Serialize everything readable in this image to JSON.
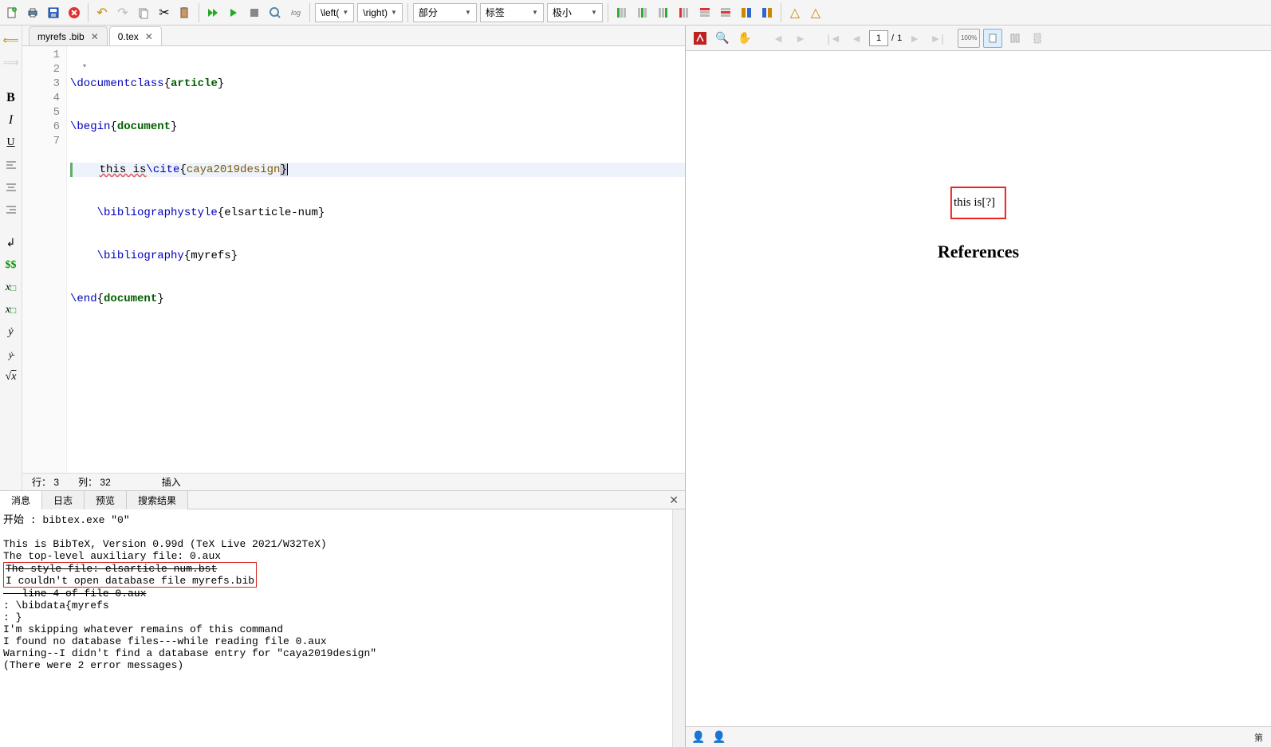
{
  "toolbar": {
    "dd_left_delim": "\\left(",
    "dd_right_delim": "\\right)",
    "dd_section": "部分",
    "dd_label": "标签",
    "dd_size": "极小"
  },
  "tabs": {
    "tab1": "myrefs .bib",
    "tab2": "0.tex"
  },
  "editor": {
    "lines": {
      "n1": "1",
      "n2": "2",
      "n3": "3",
      "n4": "4",
      "n5": "5",
      "n6": "6",
      "n7": "7"
    },
    "code": {
      "l1_cmd": "\\documentclass",
      "l1_arg": "article",
      "l2_cmd": "\\begin",
      "l2_arg": "document",
      "l3_plain": "this is",
      "l3_cmd": "\\cite",
      "l3_arg": "caya2019design",
      "l4_cmd": "\\bibliographystyle",
      "l4_arg": "elsarticle-num",
      "l5_cmd": "\\bibliography",
      "l5_arg": "myrefs",
      "l6_cmd": "\\end",
      "l6_arg": "document"
    }
  },
  "status": {
    "row_lbl": "行：",
    "row_val": "3",
    "col_lbl": "列：",
    "col_val": "32",
    "mode": "插入"
  },
  "msgs": {
    "tab_msg": "消息",
    "tab_log": "日志",
    "tab_prev": "预览",
    "tab_search": "搜索结果",
    "l1": "开始 : bibtex.exe \"0\"",
    "l3": "This is BibTeX, Version 0.99d (TeX Live 2021/W32TeX)",
    "l4": "The top-level auxiliary file: 0.aux",
    "l5": "The style file: elsarticle-num.bst",
    "l6": "I couldn't open database file myrefs.bib",
    "l7": "---line 4 of file 0.aux",
    "l8": " : \\bibdata{myrefs",
    "l9": " :                }",
    "l10": "I'm skipping whatever remains of this command",
    "l11": "I found no database files---while reading file 0.aux",
    "l12": "Warning--I didn't find a database entry for \"caya2019design\"",
    "l13": "(There were 2 error messages)"
  },
  "preview": {
    "page_cur": "1",
    "page_sep": "/",
    "page_tot": "1",
    "zoom": "100%",
    "doc_text": "this is[?]",
    "doc_ref": "References",
    "footer_right": "第"
  }
}
